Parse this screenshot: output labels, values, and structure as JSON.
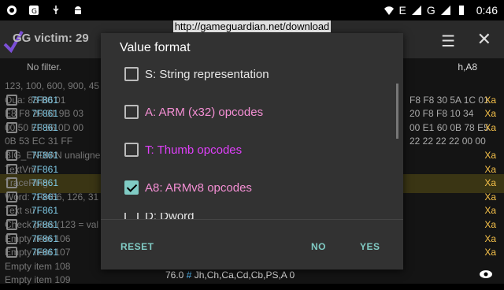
{
  "status_bar": {
    "time": "0:46",
    "signal_label": "E",
    "signal_label_2": "G"
  },
  "overlay_url": "http://gameguardian.net/download",
  "app": {
    "title_fragment": "GG victim: 29",
    "filter_text": "No filter.",
    "filter_right": "h,A8",
    "rows": [
      {
        "text": "123, 100, 600, 900, 45",
        "addr": "",
        "right": ""
      },
      {
        "text": "Qua: 83 B0 01",
        "addr": "7F861",
        "right": "Xa",
        "hex": "F8 F8 30 5A 1C 01"
      },
      {
        "text": "E8 F8 20 01 9B 03",
        "addr": "7F861",
        "right": "Xa",
        "hex": "20 F8 F8 10 34"
      },
      {
        "text": "00 50 E3 56 0D 00",
        "addr": "7F861",
        "right": "Xa",
        "hex": "00 E1 60 0B 78 E5"
      },
      {
        "text": "0B 53 EC 31 FF",
        "addr": "",
        "right": "",
        "hex": "22 22 22 22 00 00"
      },
      {
        "text": "BIG_ENDIAN unaligne",
        "addr": "7F861",
        "right": "Xa",
        "hex": ""
      },
      {
        "text": "TextVm",
        "addr": "7F861",
        "right": "Xa",
        "hex": ""
      },
      {
        "text": "TraceRing",
        "addr": "7F861",
        "right": "Xa",
        "hex": ""
      },
      {
        "text": "Word: -10456, 126, 31",
        "addr": "7F861",
        "right": "Xa",
        "hex": ""
      },
      {
        "text": "Text su",
        "addr": "7F861",
        "right": "Xa",
        "hex": ""
      },
      {
        "text": "Check pass (123 = val",
        "addr": "7F861",
        "right": "Xa",
        "hex": ""
      },
      {
        "text": "Empty item 106",
        "addr": "7F861",
        "right": "Xa",
        "hex": ""
      },
      {
        "text": "Empty item 107",
        "addr": "7F861",
        "right": "Xa",
        "hex": ""
      },
      {
        "text": "Empty item 108",
        "addr": "",
        "right": "",
        "hex": ""
      },
      {
        "text": "Empty item 109",
        "addr": "",
        "right": "",
        "hex": ""
      }
    ],
    "bottom_value": "76.0",
    "bottom_hash": "#",
    "bottom_regs": "Jh,Ch,Ca,Cd,Cb,PS,A 0"
  },
  "dialog": {
    "title": "Value format",
    "options": [
      {
        "label": "S: String representation",
        "checked": false,
        "color": "#e6e6e6"
      },
      {
        "label": "A: ARM (x32) opcodes",
        "checked": false,
        "color": "#f48fd4"
      },
      {
        "label": "T: Thumb opcodes",
        "checked": false,
        "color": "#e040fb"
      },
      {
        "label": "A8: ARMv8 opcodes",
        "checked": true,
        "color": "#f48fd4"
      },
      {
        "label": "D: Dword",
        "checked": false,
        "color": "#e6e6e6"
      }
    ],
    "buttons": {
      "reset": "RESET",
      "no": "NO",
      "yes": "YES"
    }
  },
  "colors": {
    "accent": "#80cbc4",
    "dialog_bg": "#323232"
  }
}
